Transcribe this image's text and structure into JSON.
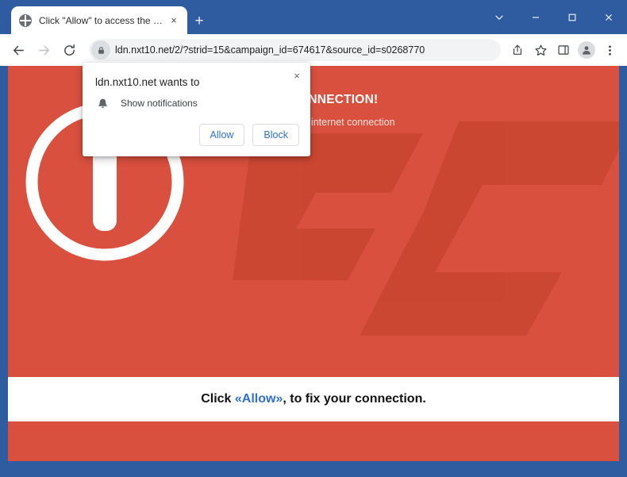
{
  "browser": {
    "tab": {
      "title": "Click \"Allow\" to access the site",
      "favicon": "globe-icon",
      "close_label": "×"
    },
    "new_tab_label": "+",
    "window_controls": {
      "tab_search_label": "⌄",
      "minimize_label": "–",
      "maximize_label": "□",
      "close_label": "×"
    },
    "toolbar": {
      "back_label": "←",
      "forward_label": "→",
      "reload_label": "↻",
      "lock_icon": "lock-icon",
      "url": "ldn.nxt10.net/2/?strid=15&campaign_id=674617&source_id=s0268770",
      "share_icon": "share-icon",
      "bookmark_icon": "star-icon",
      "sidepanel_icon": "side-panel-icon",
      "profile_icon": "profile-avatar-icon",
      "menu_icon": "three-dots-menu-icon"
    }
  },
  "dialog": {
    "title": "ldn.nxt10.net wants to",
    "permission_icon": "bell-icon",
    "permission_label": "Show notifications",
    "allow_label": "Allow",
    "block_label": "Block",
    "close_label": "×"
  },
  "page": {
    "headline": "NO INTERNET CONNECTION!",
    "subline": "Click «Allow», to fix your internet connection",
    "alert_icon": "exclamation-circle-icon",
    "watermark": "PC",
    "banner": {
      "prefix": "Click ",
      "accent": "«Allow»",
      "suffix": ", to fix your connection."
    }
  },
  "colors": {
    "page_background": "#d9503e",
    "window_frame": "#2f5ca0",
    "accent_link": "#2f6fd0",
    "dialog_button_text": "#2f6fd0",
    "banner_background": "#ffffff"
  }
}
